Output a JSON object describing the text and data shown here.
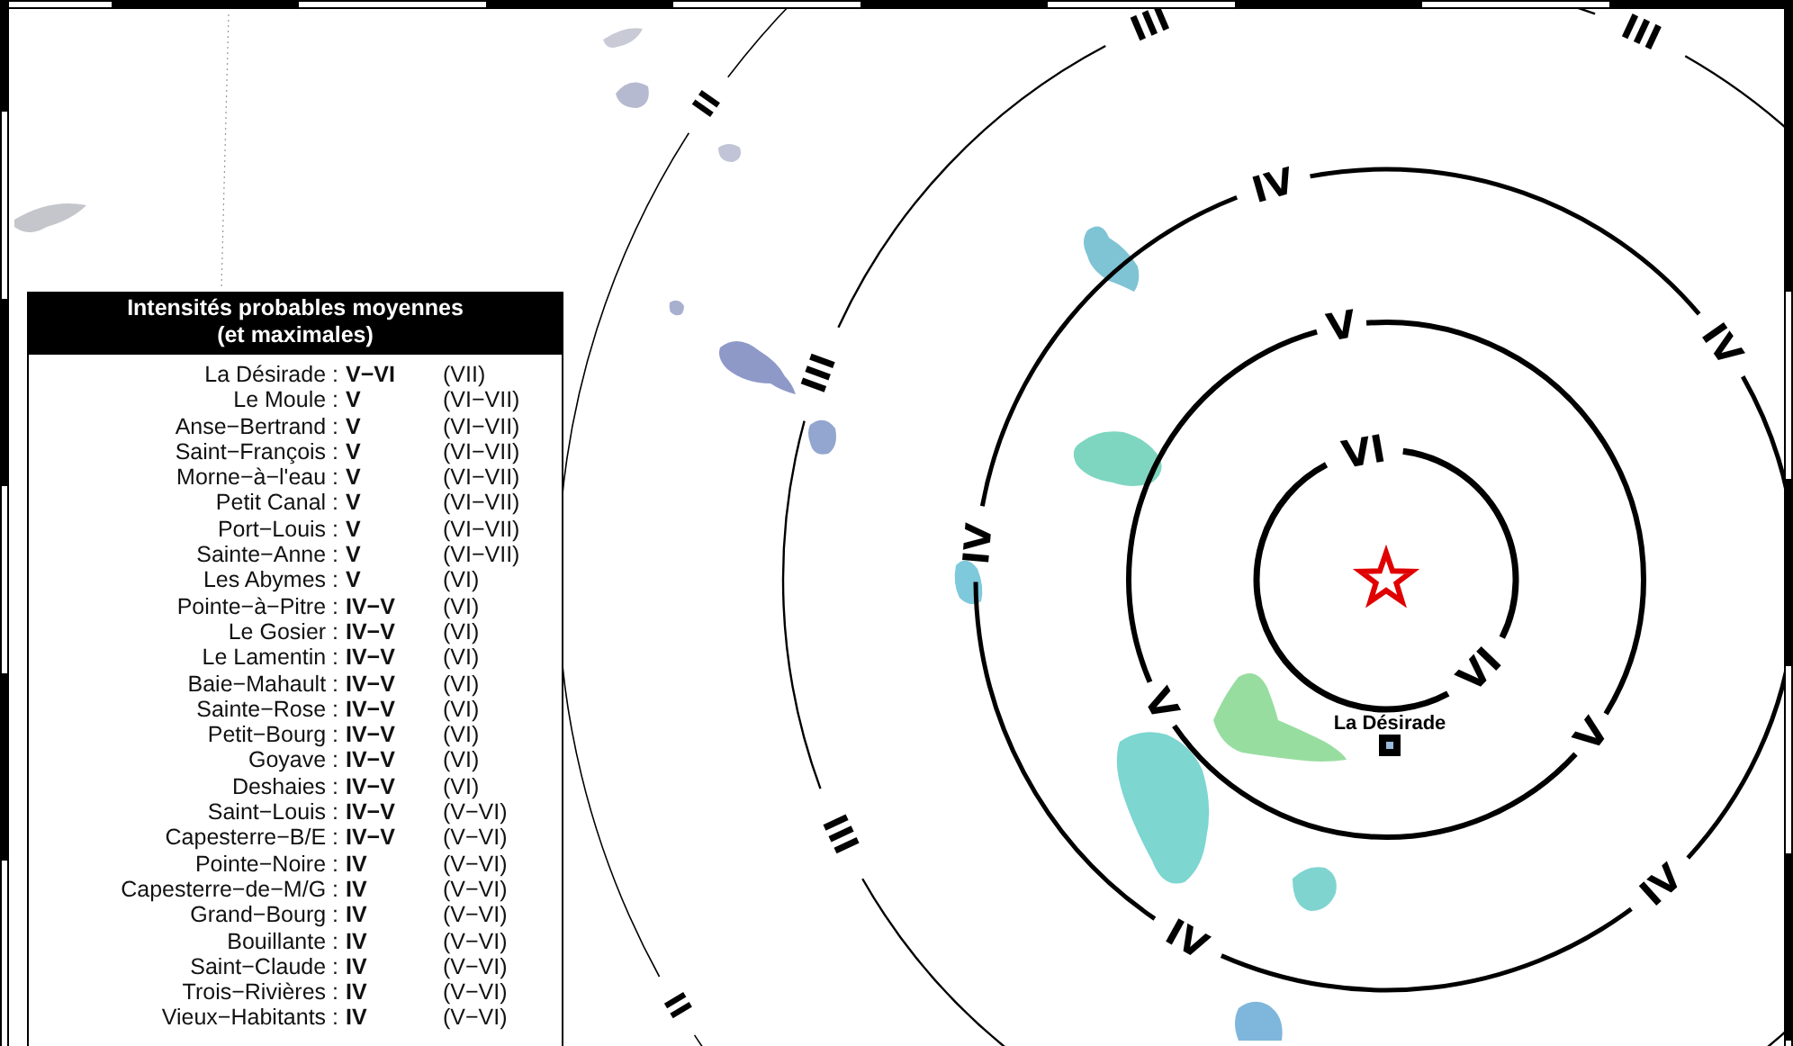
{
  "map": {
    "intensity_rings": [
      {
        "labels": [
          "VI",
          "VI"
        ]
      },
      {
        "labels": [
          "V",
          "V",
          "V"
        ]
      },
      {
        "labels": [
          "IV",
          "IV",
          "IV",
          "IV",
          "IV"
        ]
      },
      {
        "labels": [
          "III",
          "III",
          "III",
          "III"
        ]
      },
      {
        "labels": [
          "II",
          "II"
        ]
      }
    ],
    "place_label": "La Désirade"
  },
  "legend": {
    "title_lines": [
      "Intensités probables moyennes",
      "(et maximales)"
    ],
    "rows": [
      {
        "place": "La Désirade :",
        "intensity": "V−VI",
        "max": "(VII)"
      },
      {
        "place": "Le Moule :",
        "intensity": "V",
        "max": "(VI−VII)"
      },
      {
        "place": "Anse−Bertrand :",
        "intensity": "V",
        "max": "(VI−VII)"
      },
      {
        "place": "Saint−François :",
        "intensity": "V",
        "max": "(VI−VII)"
      },
      {
        "place": "Morne−à−l'eau :",
        "intensity": "V",
        "max": "(VI−VII)"
      },
      {
        "place": "Petit Canal :",
        "intensity": "V",
        "max": "(VI−VII)"
      },
      {
        "place": "Port−Louis :",
        "intensity": "V",
        "max": "(VI−VII)"
      },
      {
        "place": "Sainte−Anne :",
        "intensity": "V",
        "max": "(VI−VII)"
      },
      {
        "place": "Les Abymes :",
        "intensity": "V",
        "max": "(VI)"
      },
      {
        "place": "Pointe−à−Pitre :",
        "intensity": "IV−V",
        "max": "(VI)"
      },
      {
        "place": "Le Gosier :",
        "intensity": "IV−V",
        "max": "(VI)"
      },
      {
        "place": "Le Lamentin :",
        "intensity": "IV−V",
        "max": "(VI)"
      },
      {
        "place": "Baie−Mahault :",
        "intensity": "IV−V",
        "max": "(VI)"
      },
      {
        "place": "Sainte−Rose :",
        "intensity": "IV−V",
        "max": "(VI)"
      },
      {
        "place": "Petit−Bourg :",
        "intensity": "IV−V",
        "max": "(VI)"
      },
      {
        "place": "Goyave :",
        "intensity": "IV−V",
        "max": "(VI)"
      },
      {
        "place": "Deshaies :",
        "intensity": "IV−V",
        "max": "(VI)"
      },
      {
        "place": "Saint−Louis :",
        "intensity": "IV−V",
        "max": "(V−VI)"
      },
      {
        "place": "Capesterre−B/E :",
        "intensity": "IV−V",
        "max": "(V−VI)"
      },
      {
        "place": "Pointe−Noire :",
        "intensity": "IV",
        "max": "(V−VI)"
      },
      {
        "place": "Capesterre−de−M/G :",
        "intensity": "IV",
        "max": "(V−VI)"
      },
      {
        "place": "Grand−Bourg :",
        "intensity": "IV",
        "max": "(V−VI)"
      },
      {
        "place": "Bouillante :",
        "intensity": "IV",
        "max": "(V−VI)"
      },
      {
        "place": "Saint−Claude :",
        "intensity": "IV",
        "max": "(V−VI)"
      },
      {
        "place": "Trois−Rivières :",
        "intensity": "IV",
        "max": "(V−VI)"
      },
      {
        "place": "Vieux−Habitants :",
        "intensity": "IV",
        "max": "(V−VI)"
      }
    ]
  }
}
